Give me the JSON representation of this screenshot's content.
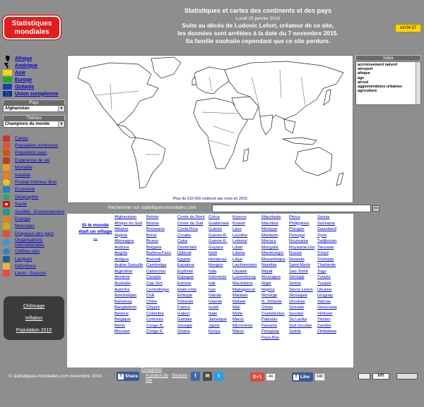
{
  "header": {
    "logo": "Statistiques mondiales",
    "clock": "14:04:57",
    "title": "Statistiques et cartes des continents et des pays",
    "date": "Lundi 25 janvier 2016",
    "message_1": "Suite au décès de Ludovic Lefort, créateur de ce site,",
    "message_2": "les données sont arrêtées à la date du 7 novembre 2015.",
    "message_3": "Sa famille souhaite cependant que ce site perdure."
  },
  "continents": [
    "Afrique",
    "Amérique",
    "Asie",
    "Europe",
    "Océanie",
    "Union européenne"
  ],
  "country_select": {
    "label": "Pays",
    "value": "Afghanistan"
  },
  "theme_select": {
    "label": "Thèmes",
    "value": "Champions du monde"
  },
  "menu": [
    "Cartes",
    "Population continents",
    "Population pays",
    "Espérance de vie",
    "Mortalité",
    "Natalité",
    "Produit Intérieur Brut",
    "Economie",
    "Géographie",
    "Santé",
    "Société - Environnement",
    "Energie",
    "Monnaies",
    "Drapeaux des pays",
    "Organisations internationales",
    "Chiffres clés",
    "Langues",
    "Définitions",
    "Liens - Sources"
  ],
  "big_buttons": [
    "Chômage",
    "Inflation",
    "Population 2015"
  ],
  "map_caption": "Plus de 210 000 visiteurs par mois en 2015",
  "index": {
    "label": "Index",
    "items": [
      "accroissement naturel",
      "aéroport",
      "afrique",
      "age",
      "alcool",
      "agglomérations urbaines",
      "agriculture"
    ]
  },
  "search": {
    "label": "Rechercher sur statistiques-mondiales.com",
    "ok": "OK"
  },
  "notice": "Si le monde était un village ...",
  "countries": [
    [
      "Afghanistan",
      "Afrique du Sud",
      "Albanie",
      "Algérie",
      "Allemagne",
      "Andorre",
      "Angola",
      "Antigua",
      "Arabie Saoudite",
      "Argentine",
      "Arménie",
      "Australie",
      "Autriche",
      "Azerbaïdjan",
      "Bahamas",
      "Bangladesh",
      "Belarus",
      "Belgique",
      "Bénin",
      "Bhoutan"
    ],
    [
      "Bolivie",
      "Bosnie",
      "Botswana",
      "Brésil",
      "Brunei",
      "Bulgarie",
      "Burkina-Faso",
      "Burundi",
      "Cambodge",
      "Cameroun",
      "Canada",
      "Cap Vert",
      "Centrafrique",
      "Chili",
      "Chine",
      "Chypre",
      "Colombie",
      "Comores",
      "Congo B.",
      "Congo K."
    ],
    [
      "Corée du Nord",
      "Corée du Sud",
      "Costa Rica",
      "Croatie",
      "Cuba",
      "Danemark",
      "Djibouti",
      "Egypte",
      "Equateur",
      "Erythrée",
      "Espagne",
      "Estonie",
      "Etats-Unis",
      "Ethiopie",
      "Finlande",
      "France",
      "Gabon",
      "Gambie",
      "Georgie",
      "Ghana"
    ],
    [
      "Grèce",
      "Guatemala",
      "Guinée",
      "Guinée-B.",
      "Guinée-E.",
      "Guyana",
      "Haïti",
      "Honduras",
      "Hongrie",
      "Inde",
      "Indonésie",
      "Irak",
      "Iran",
      "Irlande",
      "Islande",
      "Israël",
      "Italie",
      "Jamaïque",
      "Japon",
      "Kenya"
    ],
    [
      "Kosovo",
      "Koweït",
      "Laos",
      "Lesotho",
      "Lettonie",
      "Liban",
      "Liberia",
      "Libye",
      "Liechtenstein",
      "Lituanie",
      "Luxembourg",
      "Macédoine",
      "Madagascar",
      "Malaisie",
      "Malawi",
      "Mali",
      "Malte",
      "Maroc",
      "Micronésie",
      "Maroc"
    ],
    [
      "Mauritanie",
      "Mauritius",
      "Mexique",
      "Moldavie",
      "Monaco",
      "Mongolie",
      "Monténégro",
      "Mozambique",
      "Namibie",
      "Népal",
      "Nicaragua",
      "Niger",
      "Nigeria",
      "Norvège",
      "N. Zélande",
      "Oman",
      "Ouzbékistan",
      "Pakistan",
      "Panama",
      "Paraguay",
      "Pays-Bas"
    ],
    [
      "Pérou",
      "Philippines",
      "Pologne",
      "Portugal",
      "Roumanie",
      "Royaume-Uni",
      "Russie",
      "Rwanda",
      "Saint-Marin",
      "Sao-Tomé",
      "Sénégal",
      "Serbie",
      "Sierra Leone",
      "Slovaquie",
      "Slovénie",
      "Somalie",
      "Soudan",
      "Sri Lanka",
      "Sud Soudan",
      "Suède"
    ],
    [
      "Suisse",
      "Suriname",
      "Swaziland",
      "Syrie",
      "Tadjikistan",
      "Tanzanie",
      "Tchad",
      "Tchéquie",
      "Thaïlande",
      "Togo",
      "Tunisie",
      "Turquie",
      "Ukraine",
      "Uruguay",
      "Vatican",
      "Venezuela",
      "Vietnam",
      "Yémen",
      "Zambie",
      "Zimbabwe"
    ]
  ],
  "footer": {
    "copyright": "© statistiques-mondiales.com   novembre 2015",
    "share": "Share",
    "links": [
      "Enregistrer",
      "A propos du site",
      "Sources"
    ],
    "gplus": "G+1",
    "gplus_count": "44",
    "like": "Like",
    "like_count": "646",
    "badge": "XITI"
  }
}
